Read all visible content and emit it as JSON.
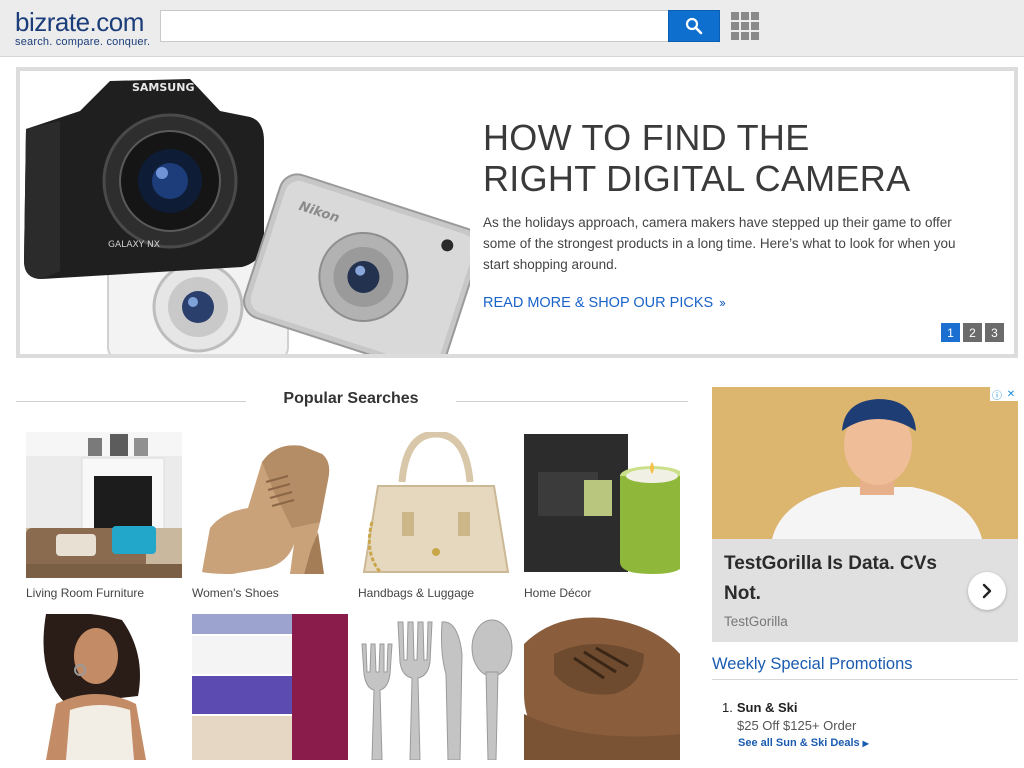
{
  "header": {
    "logo_word": "bizrate.com",
    "logo_tagline": "search. compare. conquer.",
    "search_value": "",
    "search_placeholder": "",
    "search_icon": "search-icon",
    "apps_icon": "grid-icon",
    "colors": {
      "search_button": "#0f6fcf",
      "logo": "#1b3d7a"
    }
  },
  "hero": {
    "title_line1": "HOW TO FIND THE",
    "title_line2": "RIGHT DIGITAL CAMERA",
    "text": "As the holidays approach, camera makers have stepped up their game to offer some of the strongest products in a long time. Here’s what to look for when you start shopping around.",
    "link": "READ MORE & SHOP OUR PICKS",
    "link_chevron": "››",
    "camera_brand_1": "SAMSUNG",
    "camera_model_1": "GALAXY NX",
    "camera_brand_2": "Nikon",
    "pager": [
      "1",
      "2",
      "3"
    ],
    "pager_active": "1"
  },
  "popular": {
    "title": "Popular Searches",
    "tiles": [
      {
        "label": "Living Room Furniture",
        "icon": "sofa-photo"
      },
      {
        "label": "Women's Shoes",
        "icon": "shoe-photo"
      },
      {
        "label": "Handbags & Luggage",
        "icon": "handbag-photo"
      },
      {
        "label": "Home Décor",
        "icon": "candle-photo"
      },
      {
        "label": "",
        "icon": "woman-photo"
      },
      {
        "label": "",
        "icon": "towels-photo"
      },
      {
        "label": "",
        "icon": "flatware-photo"
      },
      {
        "label": "",
        "icon": "brown-shoe-photo"
      }
    ]
  },
  "ad": {
    "headline": "TestGorilla Is Data. CVs Not.",
    "source": "TestGorilla",
    "badge_info": "ⓘ",
    "badge_close": "✕"
  },
  "promotions": {
    "title": "Weekly Special Promotions",
    "items": [
      {
        "num": "1.",
        "name": "Sun & Ski",
        "offer": "$25 Off $125+ Order",
        "link": "See all Sun & Ski Deals"
      }
    ]
  }
}
